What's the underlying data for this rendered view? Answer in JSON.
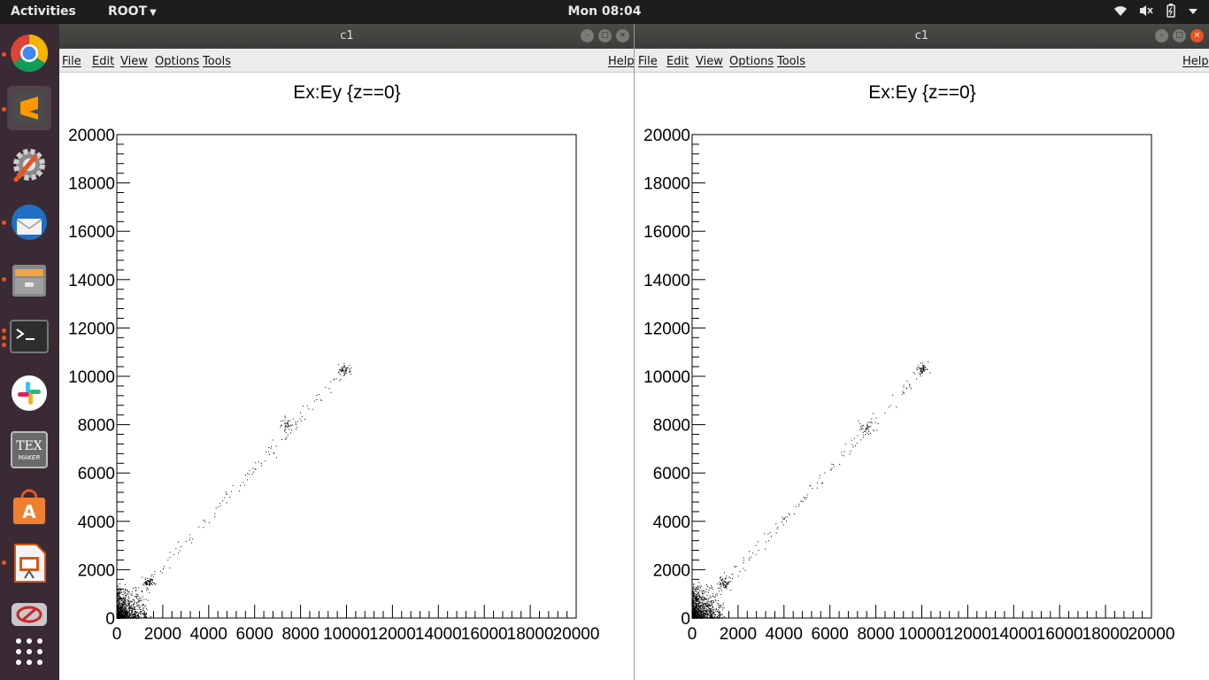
{
  "topbar": {
    "activities": "Activities",
    "app_menu": "ROOT",
    "clock": "Mon 08:04",
    "tray_icons": [
      "wifi-icon",
      "volume-muted-icon",
      "battery-icon",
      "system-menu-caret-icon"
    ]
  },
  "dock": {
    "items": [
      "chrome-icon",
      "sublime-text-icon",
      "system-settings-icon",
      "thunderbird-icon",
      "files-icon",
      "terminal-icon",
      "slack-icon",
      "texmaker-icon",
      "ubuntu-software-icon",
      "impress-icon",
      "remmina-icon",
      "show-apps-icon"
    ]
  },
  "windows": [
    {
      "title": "c1",
      "menu": {
        "file": "File",
        "edit": "Edit",
        "view": "View",
        "options": "Options",
        "tools": "Tools",
        "help": "Help"
      },
      "plot_title": "Ex:Ey {z==0}"
    },
    {
      "title": "c1",
      "menu": {
        "file": "File",
        "edit": "Edit",
        "view": "View",
        "options": "Options",
        "tools": "Tools",
        "help": "Help"
      },
      "plot_title": "Ex:Ey {z==0}"
    }
  ],
  "chart_data": [
    {
      "type": "scatter",
      "title": "Ex:Ey {z==0}",
      "xlim": [
        0,
        20000
      ],
      "ylim": [
        0,
        20000
      ],
      "xticks": [
        "0",
        "2000",
        "4000",
        "6000",
        "8000",
        "10000",
        "12000",
        "14000",
        "16000",
        "18000",
        "20000"
      ],
      "yticks": [
        "0",
        "2000",
        "4000",
        "6000",
        "8000",
        "10000",
        "12000",
        "14000",
        "16000",
        "18000",
        "20000"
      ],
      "clusters": [
        {
          "x": 300,
          "y": 400,
          "spread": 500,
          "count": 900
        },
        {
          "x": 1400,
          "y": 1500,
          "spread": 120,
          "count": 60
        },
        {
          "x": 7400,
          "y": 8000,
          "spread": 150,
          "count": 40
        },
        {
          "x": 9900,
          "y": 10300,
          "spread": 120,
          "count": 50
        }
      ],
      "diagonal": {
        "from": [
          200,
          200
        ],
        "to": [
          10000,
          10400
        ],
        "count": 140
      }
    },
    {
      "type": "scatter",
      "title": "Ex:Ey {z==0}",
      "xlim": [
        0,
        20000
      ],
      "ylim": [
        0,
        20000
      ],
      "xticks": [
        "0",
        "2000",
        "4000",
        "6000",
        "8000",
        "10000",
        "12000",
        "14000",
        "16000",
        "18000",
        "20000"
      ],
      "yticks": [
        "0",
        "2000",
        "4000",
        "6000",
        "8000",
        "10000",
        "12000",
        "14000",
        "16000",
        "18000",
        "20000"
      ],
      "clusters": [
        {
          "x": 300,
          "y": 400,
          "spread": 500,
          "count": 900
        },
        {
          "x": 1400,
          "y": 1500,
          "spread": 120,
          "count": 60
        },
        {
          "x": 7600,
          "y": 7900,
          "spread": 150,
          "count": 40
        },
        {
          "x": 10000,
          "y": 10300,
          "spread": 120,
          "count": 50
        }
      ],
      "diagonal": {
        "from": [
          200,
          200
        ],
        "to": [
          10100,
          10400
        ],
        "count": 140
      }
    }
  ]
}
